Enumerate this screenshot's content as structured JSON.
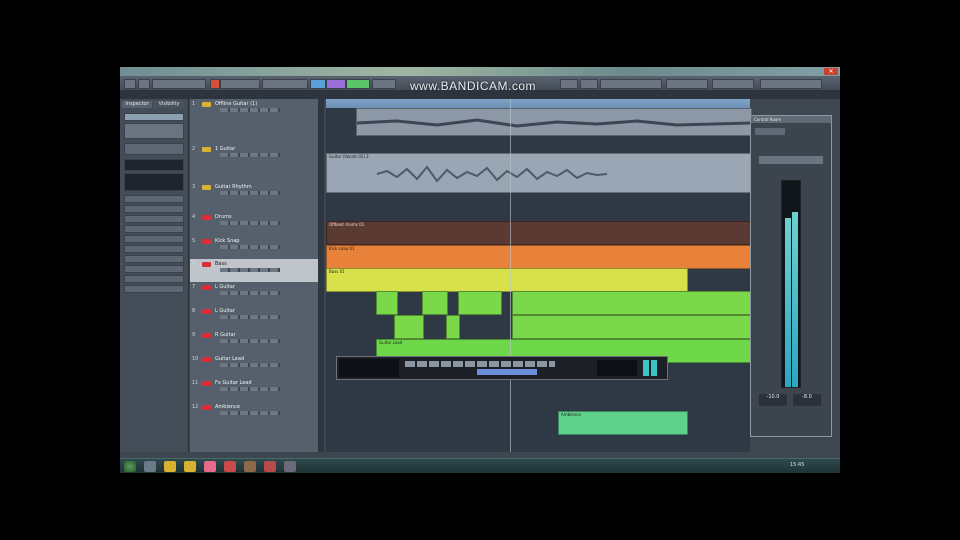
{
  "watermark": "www.BANDICAM.com",
  "inspector": {
    "tab_a": "Inspector",
    "tab_b": "Visibility"
  },
  "tracks": [
    {
      "num": "1",
      "name": "Offline Guitar (1)",
      "color": "#d8b230"
    },
    {
      "num": "2",
      "name": "1 Guitar",
      "color": "#d8b230"
    },
    {
      "num": "3",
      "name": "Guitar Rhythm",
      "color": "#d8b230"
    },
    {
      "num": "4",
      "name": "Drums",
      "color": "#d8303a"
    },
    {
      "num": "5",
      "name": "Kick Snap",
      "color": "#d8303a"
    },
    {
      "num": "6",
      "name": "Bass",
      "color": "#d8303a"
    },
    {
      "num": "7",
      "name": "L Guitar",
      "color": "#d8303a"
    },
    {
      "num": "8",
      "name": "L Guitar",
      "color": "#d8303a"
    },
    {
      "num": "9",
      "name": "R Guitar",
      "color": "#d8303a"
    },
    {
      "num": "10",
      "name": "Guitar Lead",
      "color": "#d8303a"
    },
    {
      "num": "11",
      "name": "Fx Guitar Lead",
      "color": "#d8303a"
    },
    {
      "num": "12",
      "name": "Ambience",
      "color": "#d8303a"
    }
  ],
  "clips": {
    "vocal": "Guitar (Vocals 01) 2",
    "drums": "Offbeat drums 01",
    "kick": "Kick snap 01",
    "bass": "Bass 01",
    "lead": "Guitar Lead",
    "ambience": "Ambience"
  },
  "panel": {
    "title": "Control Room",
    "peak_l": "-10.0",
    "peak_r": "-8.0"
  },
  "meter": {
    "left_level": 0.83,
    "right_level": 0.86
  },
  "colors": {
    "clip_yellow": "#d8e14a",
    "clip_green": "#7bd84a",
    "clip_orange": "#e8823a",
    "clip_teal": "#5ed28a"
  },
  "tray": {
    "time": "15:45"
  }
}
